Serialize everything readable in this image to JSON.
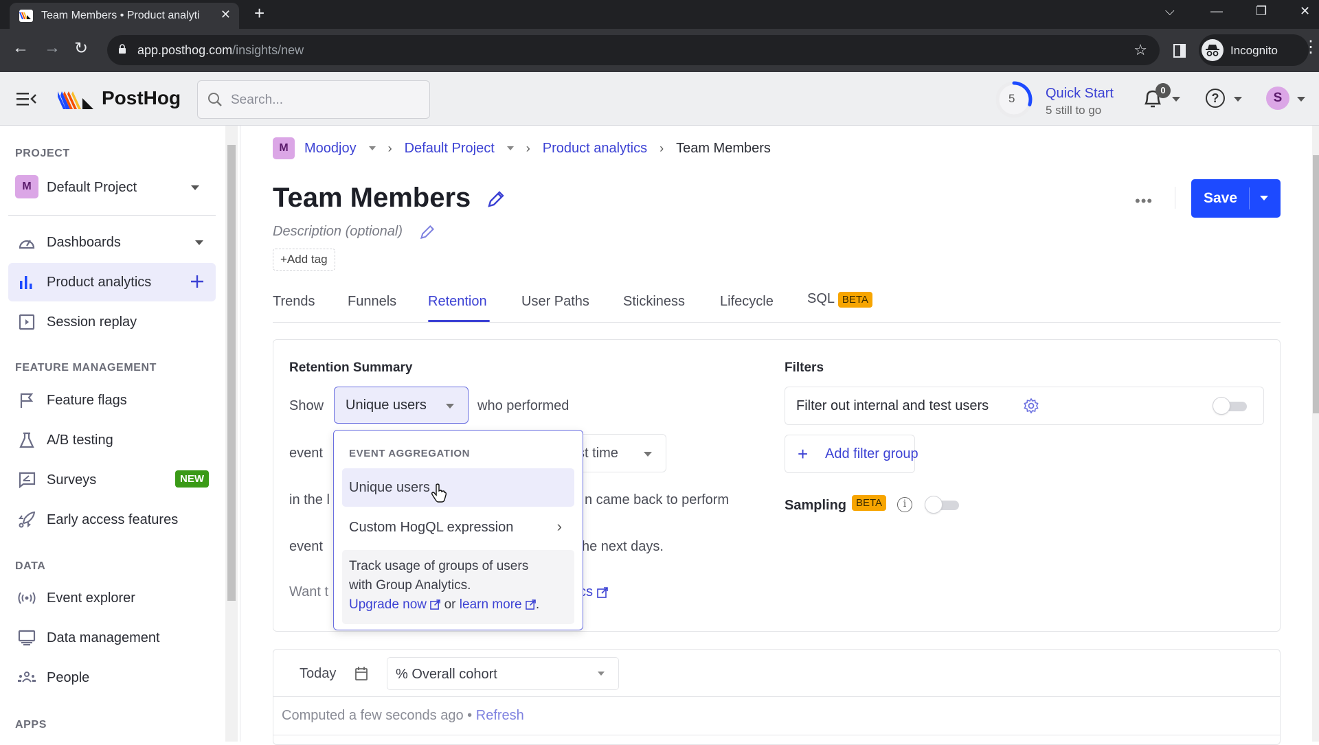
{
  "browser": {
    "tab_title": "Team Members • Product analyti",
    "url_host": "app.posthog.com",
    "url_path": "/insights/new",
    "profile_label": "Incognito"
  },
  "header": {
    "logo_text": "PostHog",
    "search_placeholder": "Search...",
    "quick_start": {
      "count": "5",
      "title": "Quick Start",
      "subtitle": "5 still to go",
      "progress_fraction": 0.3
    },
    "notifications_count": "0",
    "avatar_initial": "S"
  },
  "sidebar": {
    "project_section": "PROJECT",
    "project": {
      "avatar": "M",
      "name": "Default Project"
    },
    "items": [
      {
        "label": "Dashboards"
      },
      {
        "label": "Product analytics"
      },
      {
        "label": "Session replay"
      }
    ],
    "feature_section": "FEATURE MANAGEMENT",
    "feature_items": [
      {
        "label": "Feature flags"
      },
      {
        "label": "A/B testing"
      },
      {
        "label": "Surveys",
        "badge": "NEW"
      },
      {
        "label": "Early access features"
      }
    ],
    "data_section": "DATA",
    "data_items": [
      {
        "label": "Event explorer"
      },
      {
        "label": "Data management"
      },
      {
        "label": "People"
      }
    ],
    "apps_section": "APPS"
  },
  "breadcrumbs": {
    "org_avatar": "M",
    "org": "Moodjoy",
    "project": "Default Project",
    "section": "Product analytics",
    "current": "Team Members"
  },
  "insight": {
    "title": "Team Members",
    "description_placeholder": "Description (optional)",
    "add_tag": "+Add tag",
    "more": "•••",
    "save": "Save"
  },
  "tabs": [
    {
      "label": "Trends"
    },
    {
      "label": "Funnels"
    },
    {
      "label": "Retention",
      "active": true
    },
    {
      "label": "User Paths"
    },
    {
      "label": "Stickiness"
    },
    {
      "label": "Lifecycle"
    },
    {
      "label": "SQL",
      "badge": "BETA"
    }
  ],
  "retention": {
    "heading": "Retention Summary",
    "show": "Show",
    "show_value": "Unique users",
    "who_performed": "who performed",
    "event_prefix_1": "event",
    "time_value_partial": "st time",
    "in_the_prefix": "in the l",
    "came_back": "n came back to perform",
    "event_prefix_2": "event",
    "next_days": "he next days.",
    "want_prefix": "Want t",
    "link_suffix": "cs"
  },
  "filters": {
    "heading": "Filters",
    "internal_label": "Filter out internal and test users",
    "internal_enabled": false,
    "add_filter_group": "Add filter group",
    "sampling_label": "Sampling",
    "sampling_badge": "BETA",
    "sampling_enabled": false
  },
  "dropdown": {
    "section": "EVENT AGGREGATION",
    "items": [
      {
        "label": "Unique users",
        "hovered": true
      },
      {
        "label": "Custom HogQL expression",
        "submenu": true
      }
    ],
    "upsell_line1": "Track usage of groups of users",
    "upsell_line2": "with Group Analytics.",
    "upgrade_link": "Upgrade now",
    "or": "or",
    "learn_link": "learn more",
    "period": "."
  },
  "results": {
    "date": "Today",
    "aggregation_select": "% Overall cohort",
    "computed": "Computed a few seconds ago",
    "bullet": "•",
    "refresh": "Refresh"
  },
  "colors": {
    "primary": "#1d4aff",
    "link": "#3c42d4",
    "beta_badge": "#f7a501",
    "new_badge": "#3a9a17",
    "avatar_purple": "#dba6e6"
  }
}
